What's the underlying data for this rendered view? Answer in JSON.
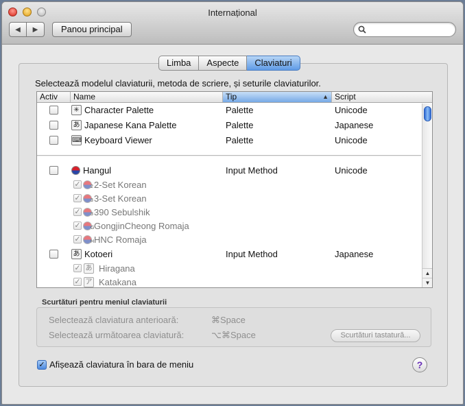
{
  "window": {
    "title": "Internațional"
  },
  "toolbar": {
    "show_all_label": "Panou principal",
    "back_glyph": "◀",
    "forward_glyph": "▶"
  },
  "search": {
    "placeholder": "",
    "icon": "magnifier-icon"
  },
  "tabs": [
    {
      "label": "Limba",
      "active": false
    },
    {
      "label": "Aspecte",
      "active": false
    },
    {
      "label": "Claviaturi",
      "active": true
    }
  ],
  "instruction": "Selectează modelul claviaturii, metoda de scriere, și seturile claviaturilor.",
  "table": {
    "headers": {
      "active": "Activ",
      "name": "Name",
      "type": "Tip",
      "script": "Script"
    },
    "palettes": [
      {
        "name": "Character Palette",
        "type": "Palette",
        "script": "Unicode",
        "icon_glyph": "✳",
        "checked": false
      },
      {
        "name": "Japanese Kana Palette",
        "type": "Palette",
        "script": "Japanese",
        "icon_glyph": "あ",
        "checked": false
      },
      {
        "name": "Keyboard Viewer",
        "type": "Palette",
        "script": "Unicode",
        "icon_glyph": "⌨",
        "checked": false
      }
    ],
    "hangul": {
      "name": "Hangul",
      "type": "Input Method",
      "script": "Unicode",
      "checked": false
    },
    "hangul_subs": [
      {
        "name": "2-Set Korean",
        "num": "2"
      },
      {
        "name": "3-Set Korean",
        "num": "3"
      },
      {
        "name": "390 Sebulshik",
        "num": "3"
      },
      {
        "name": "GongjinCheong Romaja",
        "num": "G"
      },
      {
        "name": "HNC Romaja",
        "num": "H"
      }
    ],
    "kotoeri": {
      "name": "Kotoeri",
      "type": "Input Method",
      "script": "Japanese",
      "icon_glyph": "あ",
      "checked": false
    },
    "kotoeri_subs": [
      {
        "name": "Hiragana",
        "icon_glyph": "あ"
      },
      {
        "name": "Katakana",
        "icon_glyph": "ア"
      }
    ]
  },
  "shortcuts": {
    "title": "Scurtături pentru meniul claviaturii",
    "prev_label": "Selectează claviatura anterioară:",
    "prev_key": "⌘Space",
    "next_label": "Selectează următoarea claviatură:",
    "next_key": "⌥⌘Space",
    "button_label": "Scurtături tastatură..."
  },
  "show_menu": {
    "label": "Afișează claviatura în bara de meniu",
    "checked": true
  },
  "help": {
    "glyph": "?"
  }
}
